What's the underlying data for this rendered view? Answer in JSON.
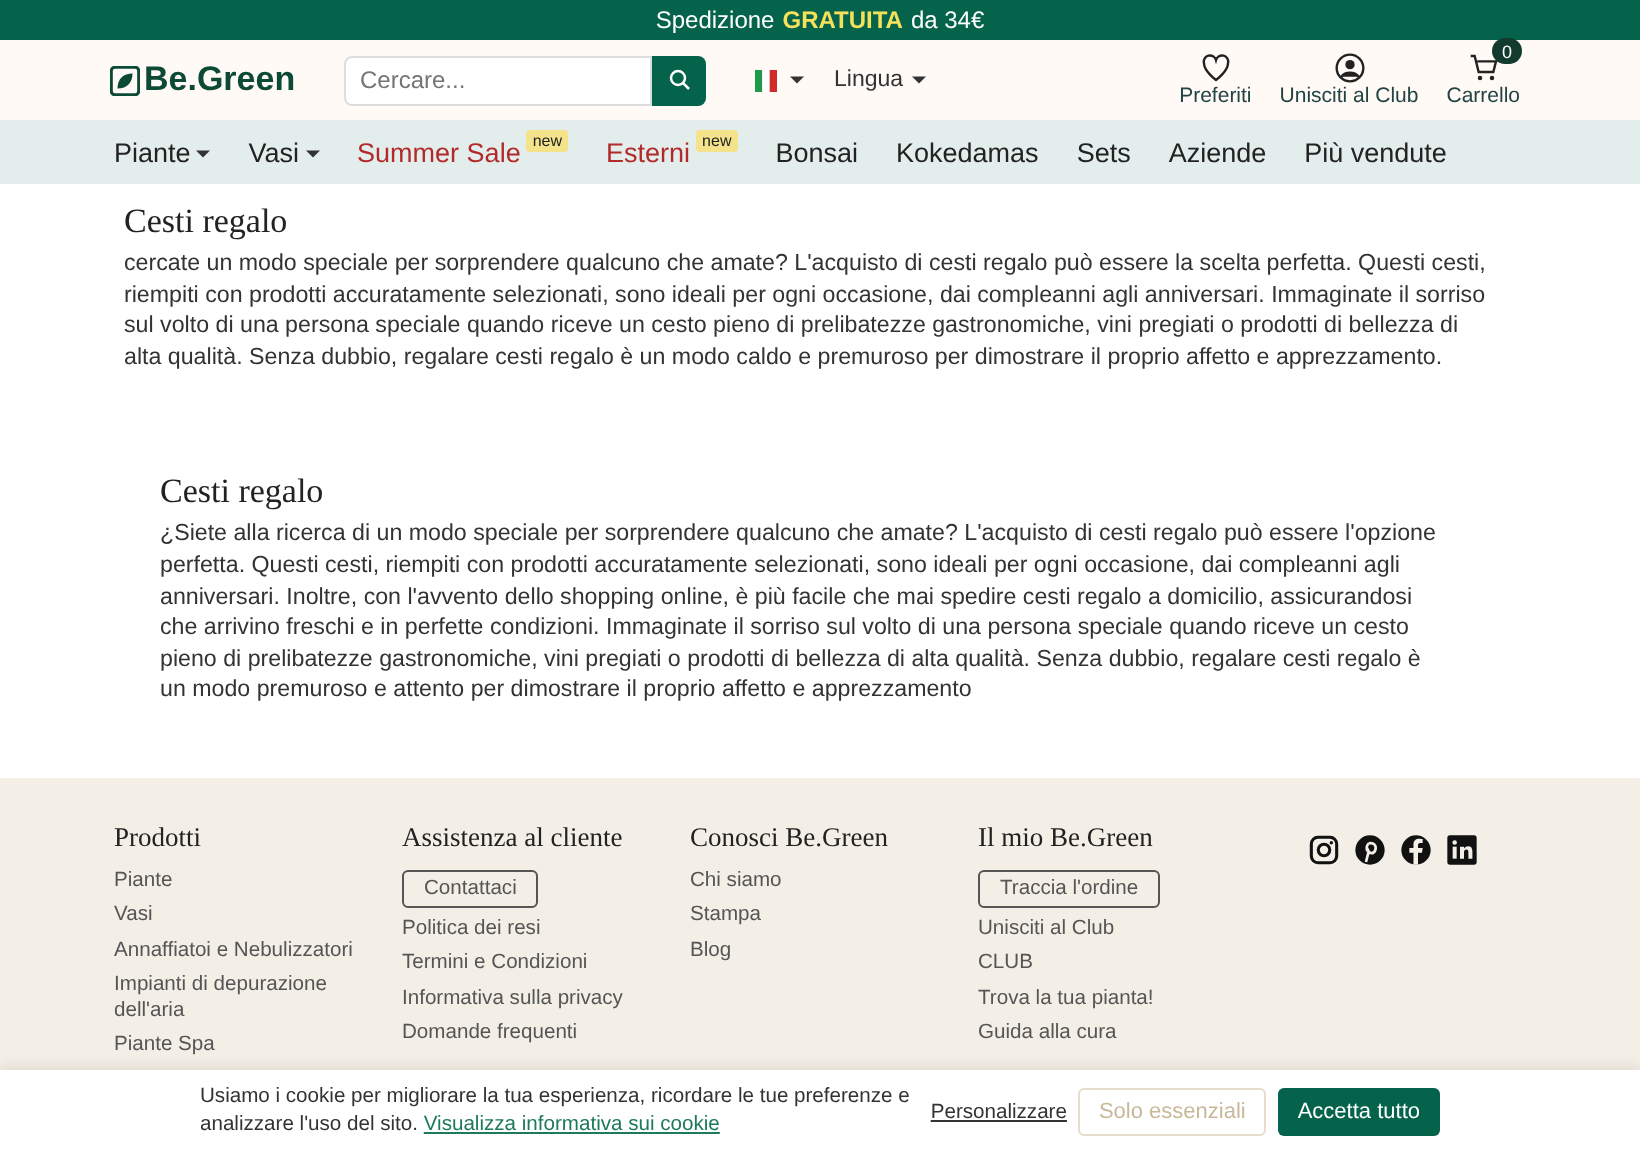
{
  "promo": {
    "parts": [
      {
        "text": "Spedizione",
        "highlight": false
      },
      {
        "text": "GRATUITA",
        "highlight": true
      },
      {
        "text": "da 34€",
        "highlight": false
      }
    ]
  },
  "header": {
    "logo": "Be.Green",
    "search": {
      "placeholder": "Cercare..."
    },
    "language": "Lingua",
    "actions": [
      {
        "kind": "heart",
        "label": "Preferiti"
      },
      {
        "kind": "user",
        "label": "Unisciti al Club"
      },
      {
        "kind": "cart",
        "label": "Carrello",
        "badge": "0"
      }
    ]
  },
  "nav": [
    {
      "label": "Piante",
      "dropdown": true,
      "sale": false
    },
    {
      "label": "Vasi",
      "dropdown": true,
      "sale": false
    },
    {
      "label": "Summer Sale",
      "dropdown": false,
      "sale": true,
      "badge": "new"
    },
    {
      "label": "Esterni",
      "dropdown": false,
      "sale": true,
      "badge": "new"
    },
    {
      "label": "Bonsai",
      "dropdown": false,
      "sale": false
    },
    {
      "label": "Kokedamas",
      "dropdown": false,
      "sale": false
    },
    {
      "label": "Sets",
      "dropdown": false,
      "sale": false
    },
    {
      "label": "Aziende",
      "dropdown": false,
      "sale": false
    },
    {
      "label": "Più vendute",
      "dropdown": false,
      "sale": false
    }
  ],
  "sections": [
    {
      "title": "Cesti regalo",
      "indented": false,
      "text": "cercate un modo speciale per sorprendere qualcuno che amate? L'acquisto di cesti regalo può essere la scelta perfetta. Questi cesti, riempiti con prodotti accuratamente selezionati, sono ideali per ogni occasione, dai compleanni agli anniversari. Immaginate il sorriso sul volto di una persona speciale quando riceve un cesto pieno di prelibatezze gastronomiche, vini pregiati o prodotti di bellezza di alta qualità. Senza dubbio, regalare cesti regalo è un modo caldo e premuroso per dimostrare il proprio affetto e apprezzamento."
    },
    {
      "title": "Cesti regalo",
      "indented": true,
      "text": "¿Siete alla ricerca di un modo speciale per sorprendere qualcuno che amate? L'acquisto di cesti regalo può essere l'opzione perfetta. Questi cesti, riempiti con prodotti accuratamente selezionati, sono ideali per ogni occasione, dai compleanni agli anniversari. Inoltre, con l'avvento dello shopping online, è più facile che mai spedire cesti regalo a domicilio, assicurandosi che arrivino freschi e in perfette condizioni. Immaginate il sorriso sul volto di una persona speciale quando riceve un cesto pieno di prelibatezze gastronomiche, vini pregiati o prodotti di bellezza di alta qualità. Senza dubbio, regalare cesti regalo è un modo premuroso e attento per dimostrare il proprio affetto e apprezzamento"
    }
  ],
  "footer": {
    "columns": [
      {
        "title": "Prodotti",
        "links": [
          "Piante",
          "Vasi",
          "Annaffiatoi e Nebulizzatori",
          "Impianti di depurazione dell'aria",
          "Piante Spa"
        ]
      },
      {
        "title": "Assistenza al cliente",
        "button": "Contattaci",
        "links": [
          "Politica dei resi",
          "Termini e Condizioni",
          "Informativa sulla privacy",
          "Domande frequenti"
        ]
      },
      {
        "title": "Conosci Be.Green",
        "links": [
          "Chi siamo",
          "Stampa",
          "Blog"
        ]
      },
      {
        "title": "Il mio Be.Green",
        "button": "Traccia l'ordine",
        "links": [
          "Unisciti al Club",
          "CLUB",
          "Trova la tua pianta!",
          "Guida alla cura"
        ]
      }
    ],
    "social": [
      {
        "kind": "instagram"
      },
      {
        "kind": "pinterest"
      },
      {
        "kind": "facebook"
      },
      {
        "kind": "linkedin"
      }
    ]
  },
  "cookie_banner": {
    "text": "Usiamo i cookie per migliorare la tua esperienza, ricordare le tue preferenze e analizzare l'uso del sito.",
    "link": "Visualizza informativa sui cookie",
    "buttons": [
      {
        "label": "Personalizzare",
        "kind": "link"
      },
      {
        "label": "Solo essenziali",
        "kind": "outline"
      },
      {
        "label": "Accetta tutto",
        "kind": "primary"
      }
    ]
  }
}
